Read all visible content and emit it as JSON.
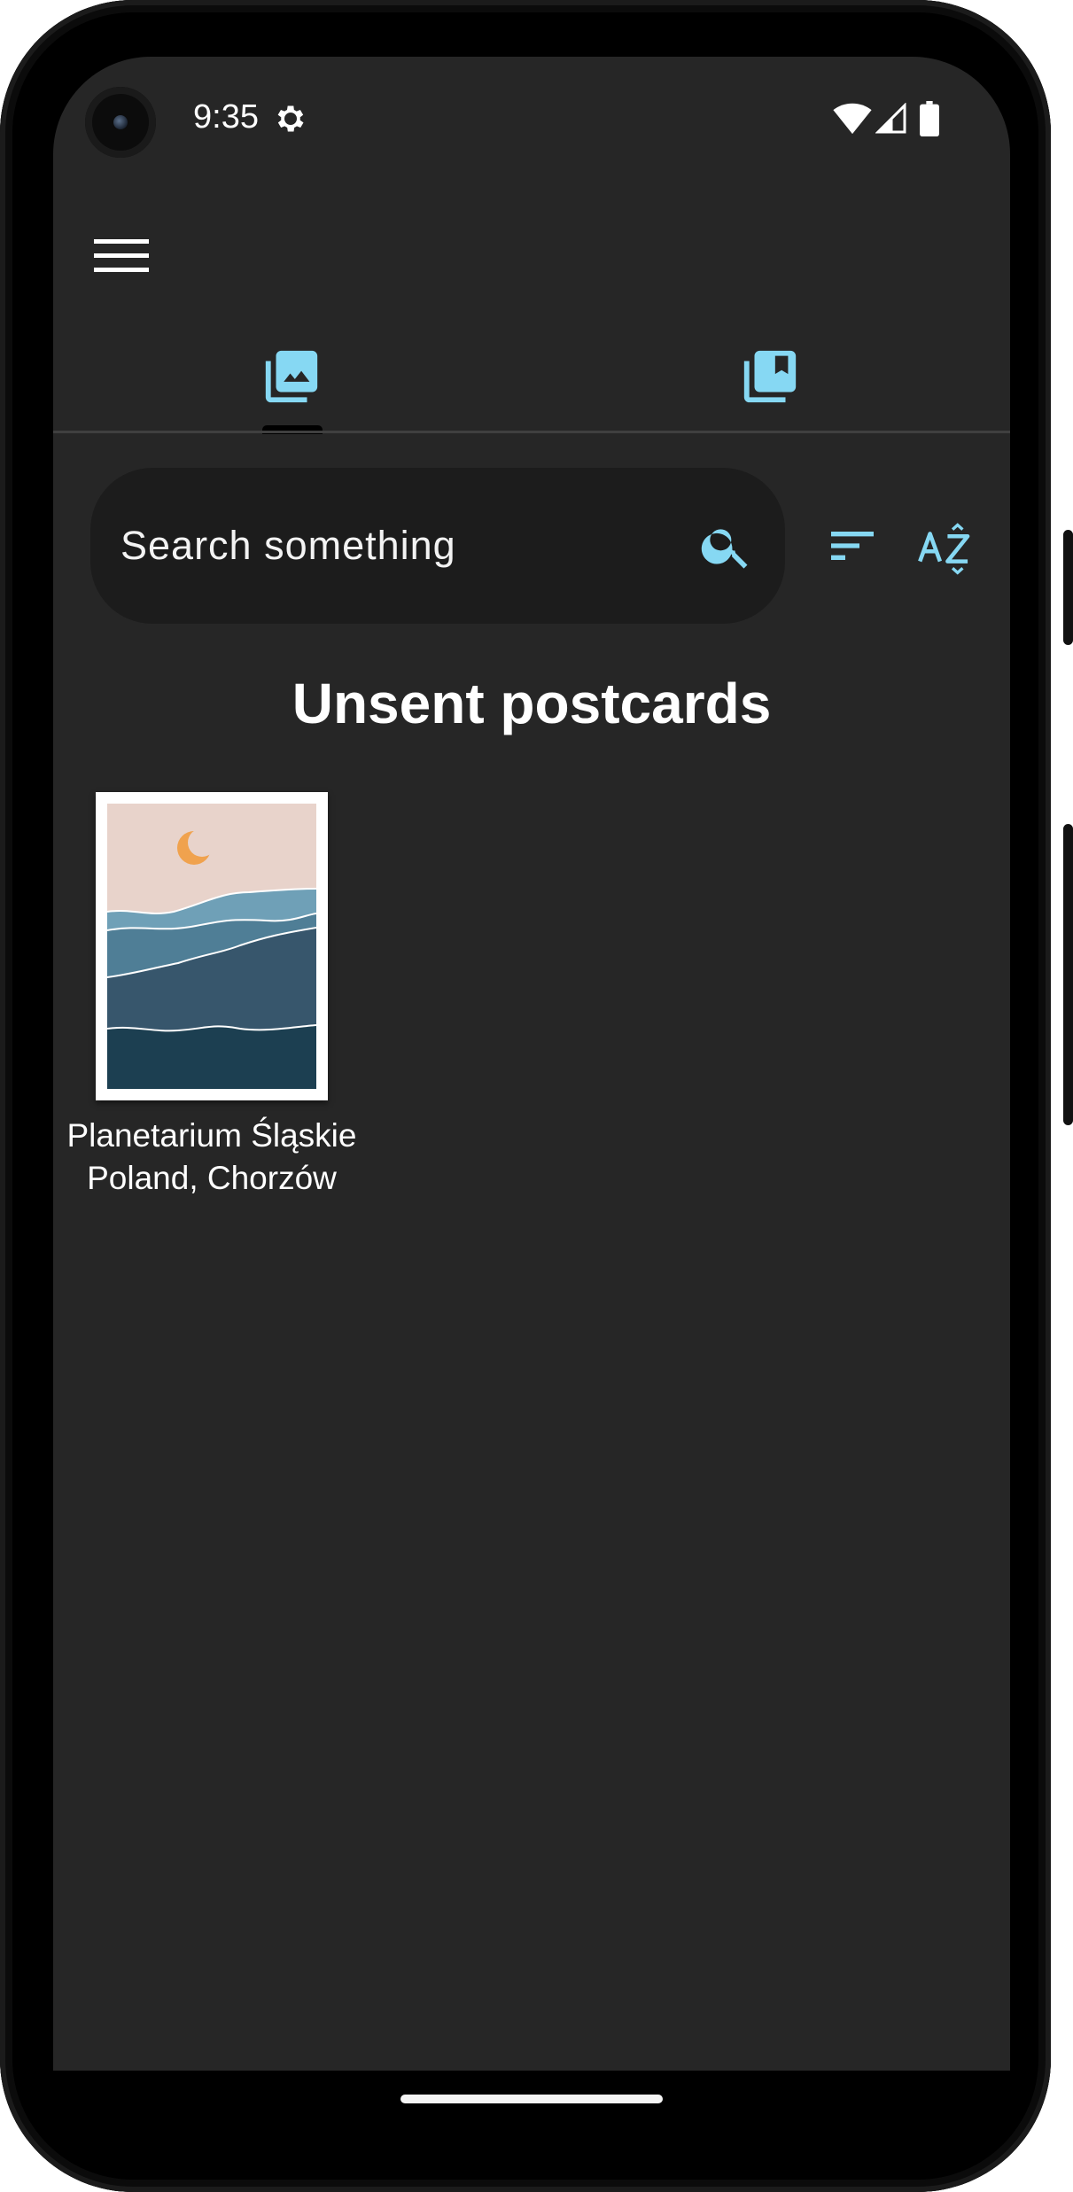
{
  "status_bar": {
    "time": "9:35",
    "icons": [
      "settings-gear-icon",
      "wifi-icon",
      "cell-signal-icon",
      "battery-icon"
    ]
  },
  "app_bar": {
    "menu_icon": "hamburger-menu-icon"
  },
  "tabs": [
    {
      "icon": "photo-library-icon",
      "selected": true
    },
    {
      "icon": "bookmark-library-icon",
      "selected": false
    }
  ],
  "search": {
    "placeholder": "Search something",
    "icon": "search-icon"
  },
  "toolbar": {
    "sort_icon": "sort-lines-icon",
    "alpha_sort_icon": "sort-az-icon"
  },
  "heading": "Unsent postcards",
  "postcards": [
    {
      "title": "Planetarium Śląskie",
      "location": "Poland, Chorzów",
      "image": "mountain-landscape-moon-illustration"
    }
  ],
  "colors": {
    "background": "#262626",
    "search_background": "#1c1c1c",
    "accent": "#86d8f3",
    "text": "#ffffff"
  }
}
